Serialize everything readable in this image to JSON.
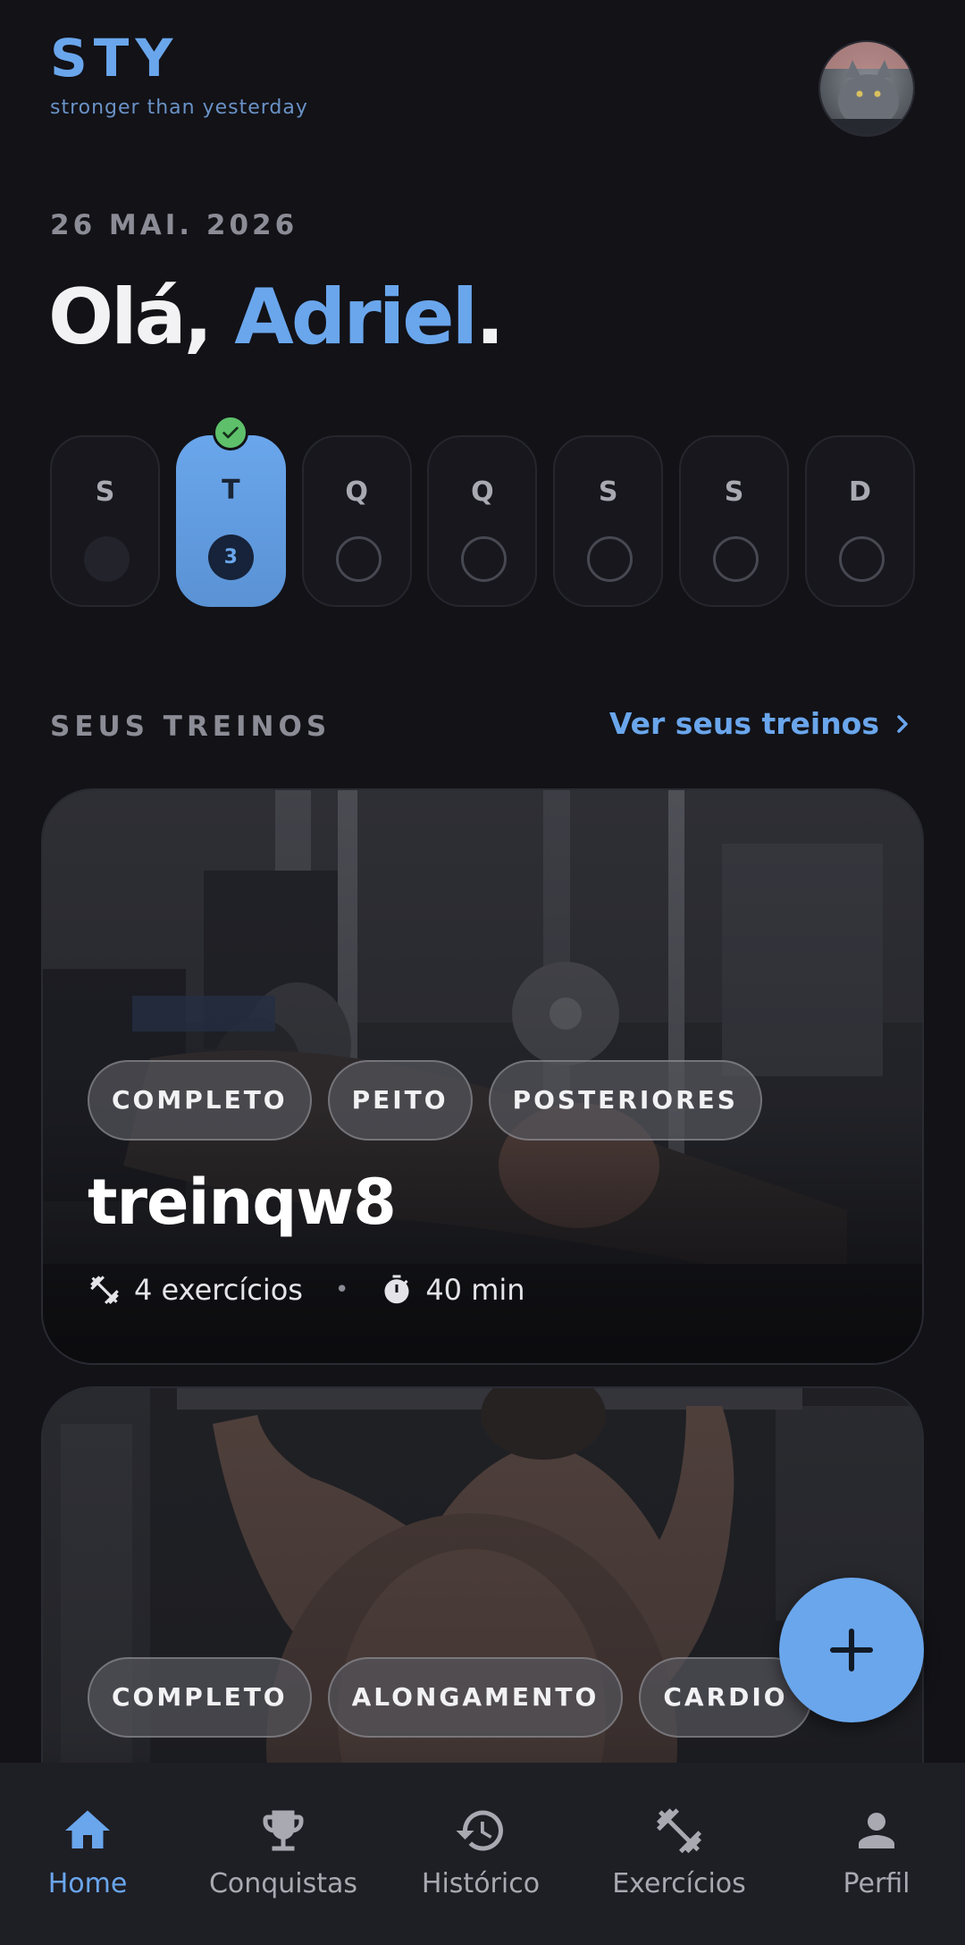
{
  "header": {
    "brand": "STY",
    "tagline": "stronger than yesterday"
  },
  "date": "26 MAI. 2026",
  "greeting": {
    "prefix": "Olá, ",
    "name": "Adriel",
    "suffix": "."
  },
  "week": {
    "days": [
      {
        "letter": "S",
        "state": "filled"
      },
      {
        "letter": "T",
        "state": "active",
        "count": "3",
        "completed": true
      },
      {
        "letter": "Q",
        "state": "empty"
      },
      {
        "letter": "Q",
        "state": "empty"
      },
      {
        "letter": "S",
        "state": "empty"
      },
      {
        "letter": "S",
        "state": "empty"
      },
      {
        "letter": "D",
        "state": "empty"
      }
    ]
  },
  "workouts_section": {
    "title": "SEUS TREINOS",
    "see_all": "Ver seus treinos"
  },
  "workouts": [
    {
      "tags": [
        "COMPLETO",
        "PEITO",
        "POSTERIORES"
      ],
      "name": "treinqw8",
      "exercises": "4 exercícios",
      "duration": "40 min"
    },
    {
      "tags": [
        "COMPLETO",
        "ALONGAMENTO",
        "CARDIO"
      ]
    }
  ],
  "nav": {
    "items": [
      {
        "label": "Home",
        "icon": "home-icon",
        "active": true
      },
      {
        "label": "Conquistas",
        "icon": "trophy-icon",
        "active": false
      },
      {
        "label": "Histórico",
        "icon": "history-icon",
        "active": false
      },
      {
        "label": "Exercícios",
        "icon": "dumbbell-icon",
        "active": false
      },
      {
        "label": "Perfil",
        "icon": "person-icon",
        "active": false
      }
    ]
  },
  "colors": {
    "background": "#121217",
    "accent": "#6aa6ec",
    "success": "#5ec06a",
    "nav_background": "#1e1e25"
  }
}
